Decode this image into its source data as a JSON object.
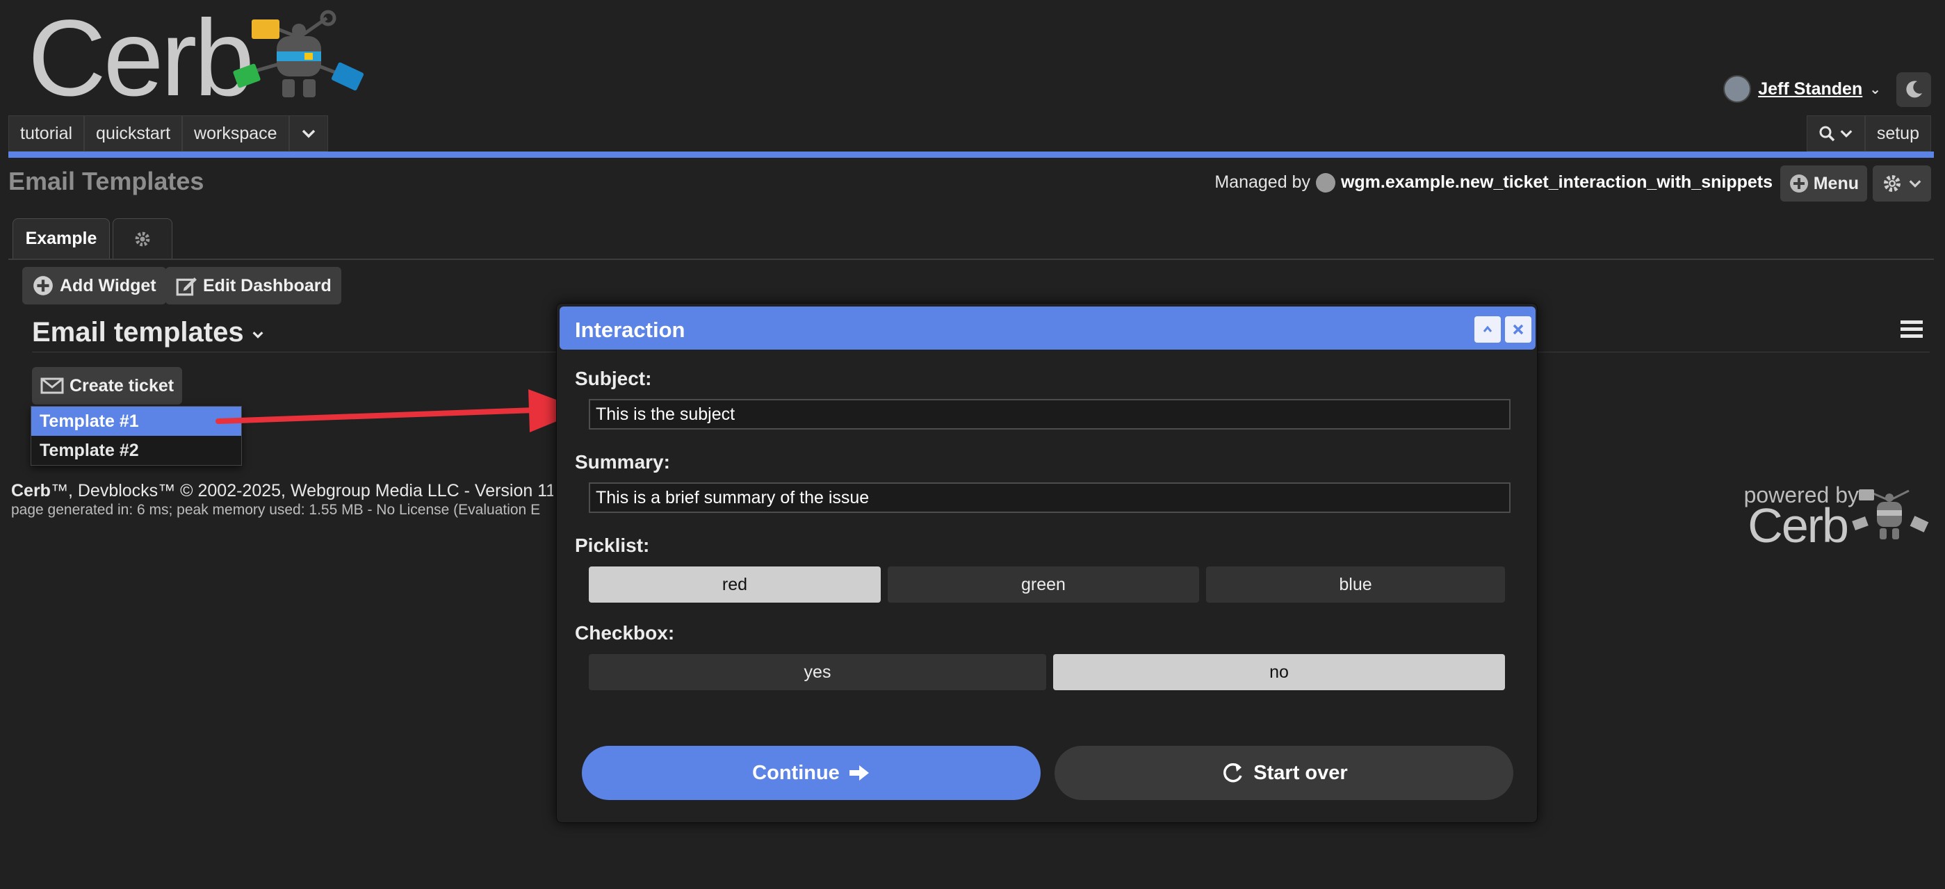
{
  "logo": {
    "text": "Cerb"
  },
  "user": {
    "name": "Jeff Standen"
  },
  "nav": {
    "tabs": [
      "tutorial",
      "quickstart",
      "workspace"
    ],
    "setup_label": "setup"
  },
  "page": {
    "title": "Email Templates",
    "managed_by_label": "Managed by",
    "managed_by_value": "wgm.example.new_ticket_interaction_with_snippets",
    "menu_label": "Menu"
  },
  "tabs": {
    "example": "Example"
  },
  "dashboard": {
    "add_widget": "Add Widget",
    "edit_dashboard": "Edit Dashboard"
  },
  "widget": {
    "title": "Email templates",
    "create_ticket": "Create ticket",
    "dropdown": [
      "Template #1",
      "Template #2"
    ],
    "dropdown_selected": 0
  },
  "footer": {
    "line1_brand": "Cerb",
    "line1_rest": "™, Devblocks™ © 2002-2025, Webgroup Media LLC - Version 11.1",
    "line2": "page generated in: 6 ms; peak memory used: 1.55 MB - No License (Evaluation E"
  },
  "powered": {
    "label": "powered by",
    "brand": "Cerb"
  },
  "dialog": {
    "title": "Interaction",
    "subject_label": "Subject:",
    "subject_value": "This is the subject",
    "summary_label": "Summary:",
    "summary_value": "This is a brief summary of the issue",
    "picklist_label": "Picklist:",
    "picklist_options": [
      "red",
      "green",
      "blue"
    ],
    "picklist_selected": "red",
    "checkbox_label": "Checkbox:",
    "checkbox_options": [
      "yes",
      "no"
    ],
    "checkbox_selected": "no",
    "continue_label": "Continue",
    "start_over_label": "Start over"
  },
  "colors": {
    "accent": "#5b84e6",
    "background": "#212121",
    "arrow": "#e8313b"
  }
}
